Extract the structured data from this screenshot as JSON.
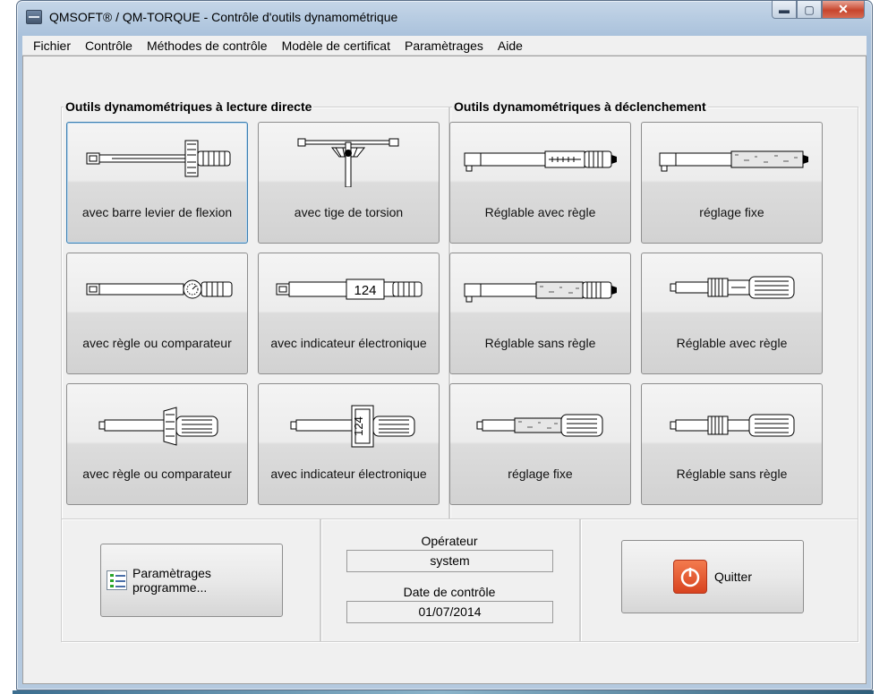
{
  "window": {
    "title": "QMSOFT® / QM-TORQUE - Contrôle d'outils dynamométrique"
  },
  "menu": [
    "Fichier",
    "Contrôle",
    "Méthodes de contrôle",
    "Modèle de certificat",
    "Paramètrages",
    "Aide"
  ],
  "groups": {
    "direct": {
      "title": "Outils dynamométriques à lecture directe",
      "buttons": [
        {
          "label": "avec barre levier de flexion",
          "icon": "beam-wrench-icon"
        },
        {
          "label": "avec tige de torsion",
          "icon": "torsion-wrench-icon"
        },
        {
          "label": "avec règle ou comparateur",
          "icon": "dial-wrench-icon"
        },
        {
          "label": "avec indicateur électronique",
          "icon": "electronic-wrench-icon",
          "display": "124"
        },
        {
          "label": "avec règle ou comparateur",
          "icon": "dial-screwdriver-icon"
        },
        {
          "label": "avec indicateur électronique",
          "icon": "electronic-screwdriver-icon",
          "display": "124"
        }
      ]
    },
    "trigger": {
      "title": "Outils dynamométriques à déclenchement",
      "buttons": [
        {
          "label": "Réglable avec règle",
          "icon": "adjustable-scale-wrench-icon"
        },
        {
          "label": "réglage fixe",
          "icon": "fixed-wrench-icon"
        },
        {
          "label": "Réglable sans règle",
          "icon": "adjustable-wrench-icon"
        },
        {
          "label": "Réglable avec règle",
          "icon": "adjustable-scale-screwdriver-icon"
        },
        {
          "label": "réglage fixe",
          "icon": "fixed-screwdriver-icon"
        },
        {
          "label": "Réglable sans règle",
          "icon": "adjustable-screwdriver-icon"
        }
      ]
    }
  },
  "program_settings": {
    "label": "Paramètrages programme..."
  },
  "operator": {
    "label": "Opérateur",
    "value": "system"
  },
  "check_date": {
    "label": "Date de contrôle",
    "value": "01/07/2014"
  },
  "quit": {
    "label": "Quitter"
  }
}
